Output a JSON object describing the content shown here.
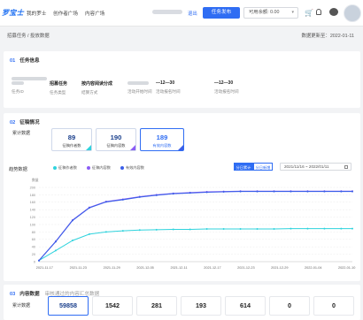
{
  "topnav": {
    "logo": "罗宝士",
    "items": [
      "我的罗士",
      "创作者广场",
      "内容广场"
    ],
    "exit": "退出",
    "publish": "任务发布",
    "balance": "可用余额: 0.00"
  },
  "breadcrumb": "招募任务 / 投放数据",
  "update_time": "数据更新至：2022-01-11",
  "task_info": {
    "num": "01",
    "title": "任务信息",
    "fields": [
      {
        "value": "招募任务",
        "label": "任务类型"
      },
      {
        "value": "按内容阅读分成",
        "label": "结算方式"
      },
      {
        "value": "—12—30",
        "label": "活动报名时间"
      },
      {
        "value": "—12—30",
        "label": "活动报名时间"
      },
      {
        "value": "—12—30",
        "label": "活动实际下线日期"
      }
    ],
    "labels": [
      "任务ID",
      "任务名称",
      "活动开始时间"
    ]
  },
  "collect": {
    "num": "02",
    "title": "征稿情况",
    "cumulative_label": "累计数据",
    "stats": [
      {
        "value": "89",
        "label": "征稿作者数"
      },
      {
        "value": "190",
        "label": "征稿内容数"
      },
      {
        "value": "189",
        "label": "有效内容数"
      }
    ],
    "trend_title": "趋势数据",
    "legend": [
      {
        "name": "征稿作者数",
        "color": "#2fd3dd"
      },
      {
        "name": "征稿内容数",
        "color": "#8b5cf6"
      },
      {
        "name": "有效内容数",
        "color": "#3b5ee8"
      }
    ],
    "toggle_on": "分日累计",
    "toggle_off": "分日新增",
    "date_range": "2021/11/16  ~  2022/01/11"
  },
  "chart_data": {
    "type": "line",
    "ylabel": "数量",
    "ylim": [
      0,
      200
    ],
    "yticks": [
      0,
      20,
      40,
      60,
      80,
      100,
      120,
      140,
      160,
      180,
      200
    ],
    "x_ticks": [
      "2021-11-17",
      "2021-11-23",
      "2021-11-29",
      "2021-12-05",
      "2021-12-11",
      "2021-12-17",
      "2021-12-23",
      "2021-12-29",
      "2022-01-04",
      "2022-01-10"
    ],
    "x_start": "2021-11-16",
    "x_end": "2022-01-11",
    "series": [
      {
        "name": "征稿作者数",
        "color": "#2fd3dd",
        "x": [
          "2021-11-16",
          "2021-11-19",
          "2021-11-22",
          "2021-11-25",
          "2021-11-28",
          "2021-12-01",
          "2021-12-04",
          "2021-12-07",
          "2021-12-10",
          "2021-12-13",
          "2021-12-16",
          "2021-12-19",
          "2021-12-22",
          "2021-12-25",
          "2021-12-28",
          "2021-12-31",
          "2022-01-03",
          "2022-01-06",
          "2022-01-09",
          "2022-01-11"
        ],
        "values": [
          3,
          30,
          57,
          74,
          80,
          83,
          85,
          86,
          87,
          87,
          88,
          88,
          88,
          88,
          88,
          89,
          89,
          89,
          89,
          89
        ]
      },
      {
        "name": "征稿内容数",
        "color": "#8b5cf6",
        "x": [
          "2021-11-16",
          "2021-11-19",
          "2021-11-22",
          "2021-11-25",
          "2021-11-28",
          "2021-12-01",
          "2021-12-04",
          "2021-12-07",
          "2021-12-10",
          "2021-12-13",
          "2021-12-16",
          "2021-12-19",
          "2021-12-22",
          "2021-12-25",
          "2021-12-28",
          "2021-12-31",
          "2022-01-03",
          "2022-01-06",
          "2022-01-09",
          "2022-01-11"
        ],
        "values": [
          3,
          55,
          112,
          146,
          162,
          168,
          175,
          180,
          184,
          186,
          188,
          189,
          190,
          190,
          190,
          190,
          190,
          190,
          190,
          190
        ]
      },
      {
        "name": "有效内容数",
        "color": "#3b5ee8",
        "x": [
          "2021-11-16",
          "2021-11-19",
          "2021-11-22",
          "2021-11-25",
          "2021-11-28",
          "2021-12-01",
          "2021-12-04",
          "2021-12-07",
          "2021-12-10",
          "2021-12-13",
          "2021-12-16",
          "2021-12-19",
          "2021-12-22",
          "2021-12-25",
          "2021-12-28",
          "2021-12-31",
          "2022-01-03",
          "2022-01-06",
          "2022-01-09",
          "2022-01-11"
        ],
        "values": [
          3,
          54,
          111,
          145,
          161,
          167,
          174,
          179,
          183,
          185,
          187,
          188,
          189,
          189,
          189,
          189,
          189,
          189,
          189,
          189
        ]
      }
    ]
  },
  "content": {
    "num": "03",
    "title": "内容数据",
    "subtitle": "审核通过的内容汇总数据",
    "cumulative_label": "累计数据",
    "stats": [
      "59858",
      "1542",
      "281",
      "193",
      "614",
      "0",
      "0"
    ]
  }
}
